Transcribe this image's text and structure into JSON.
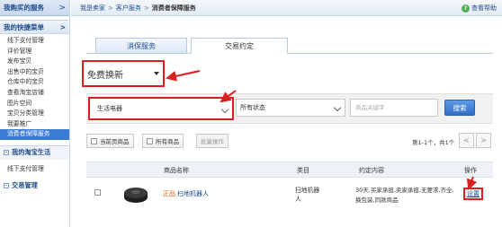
{
  "sidebar": {
    "header": "我购买的服务",
    "group_title": "我的快捷菜单",
    "items": [
      "线下支付管理",
      "评价管理",
      "发布宝贝",
      "出售中的宝贝",
      "仓库中的宝贝",
      "查看淘宝店铺",
      "图片空间",
      "宝贝分类管理",
      "我要推广",
      "消费者保障服务"
    ],
    "section_life": "我的淘宝生活",
    "sub_life": "线下支付管理",
    "section_trade": "交易管理",
    "arrow": ">"
  },
  "topbar": {
    "crumb1": "我是卖家",
    "crumb2": "客户服务",
    "current": "消费者保障服务",
    "sep": ">",
    "help": "查看帮助",
    "help_icon": "?"
  },
  "tabs": {
    "inactive": "消保服务",
    "active": "交易约定"
  },
  "free_dropdown": {
    "value": "免费换新"
  },
  "filters": {
    "category": "生活电器",
    "status": "所有状态",
    "keyword_placeholder": "商品关键字",
    "search": "搜索"
  },
  "actions": {
    "current_page": "当前页商品",
    "all_items": "所有商品",
    "batch": "批量操作",
    "pager_text": "第1-1个，共1个",
    "prev": "<",
    "next": ">"
  },
  "table": {
    "headers": {
      "name": "商品名称",
      "category": "类目",
      "promise": "约定内容",
      "action": "操作"
    },
    "rows": [
      {
        "tag": "正品",
        "name": "扫地机器人",
        "category": "扫地机器人",
        "promise": "30天,买家承担,卖家承担,无要求,齐全,换包装,同款商品",
        "action": "设置"
      }
    ]
  },
  "colors": {
    "accent": "#3a7bd5",
    "link": "#1c4a8c",
    "annotation": "#d92020",
    "help": "#4caf50"
  }
}
